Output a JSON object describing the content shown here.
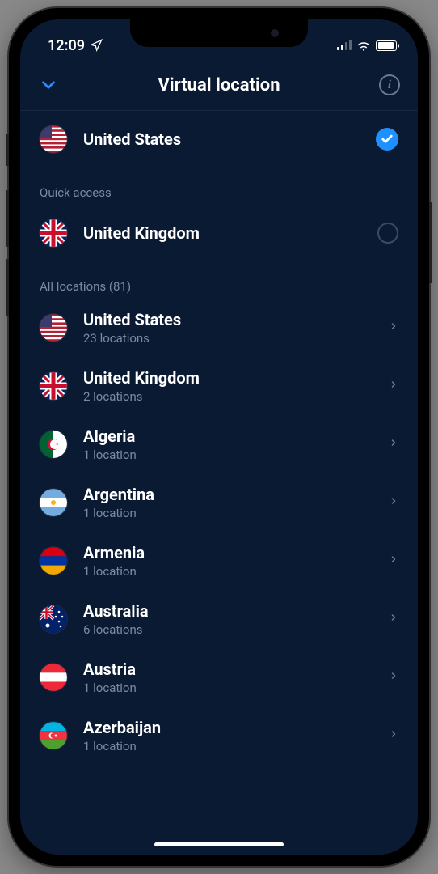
{
  "status": {
    "time": "12:09"
  },
  "header": {
    "title": "Virtual location"
  },
  "selected": {
    "name": "United States",
    "flag": "us"
  },
  "quick_access": {
    "label": "Quick access",
    "items": [
      {
        "name": "United Kingdom",
        "flag": "gb",
        "selected": false
      }
    ]
  },
  "all_locations": {
    "label": "All locations (81)",
    "count": 81,
    "items": [
      {
        "name": "United States",
        "sub": "23 locations",
        "flag": "us"
      },
      {
        "name": "United Kingdom",
        "sub": "2 locations",
        "flag": "gb"
      },
      {
        "name": "Algeria",
        "sub": "1 location",
        "flag": "dz"
      },
      {
        "name": "Argentina",
        "sub": "1 location",
        "flag": "ar"
      },
      {
        "name": "Armenia",
        "sub": "1 location",
        "flag": "am"
      },
      {
        "name": "Australia",
        "sub": "6 locations",
        "flag": "au"
      },
      {
        "name": "Austria",
        "sub": "1 location",
        "flag": "at"
      },
      {
        "name": "Azerbaijan",
        "sub": "1 location",
        "flag": "az"
      }
    ]
  }
}
